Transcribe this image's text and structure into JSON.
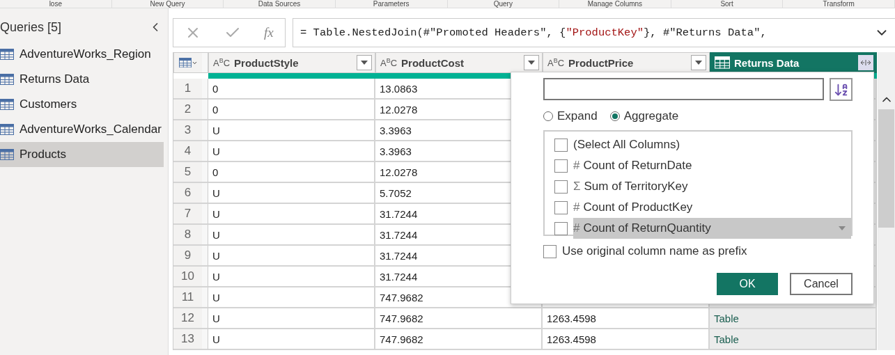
{
  "ribbon": {
    "groups": [
      "lose",
      "New Query",
      "Data Sources",
      "Parameters",
      "Query",
      "Manage Columns",
      "Sort",
      "Transform"
    ]
  },
  "queries": {
    "title": "Queries [5]",
    "items": [
      {
        "label": "AdventureWorks_Region",
        "selected": false
      },
      {
        "label": "Returns Data",
        "selected": false
      },
      {
        "label": "Customers",
        "selected": false
      },
      {
        "label": "AdventureWorks_Calendar",
        "selected": false
      },
      {
        "label": "Products",
        "selected": true
      }
    ]
  },
  "formula_bar": {
    "fx": "fx",
    "segments": [
      {
        "text": "= Table.NestedJoin(#\"Promoted Headers\", {",
        "kind": "plain"
      },
      {
        "text": "\"ProductKey\"",
        "kind": "string"
      },
      {
        "text": "}, #\"Returns Data\",",
        "kind": "plain"
      }
    ]
  },
  "table": {
    "columns": [
      {
        "name": "ProductStyle",
        "kind": "text",
        "type_icon": "A$^{B}$C",
        "selected": false
      },
      {
        "name": "ProductCost",
        "kind": "text",
        "type_icon": "A$^{B}$C",
        "selected": false
      },
      {
        "name": "ProductPrice",
        "kind": "text",
        "type_icon": "A$^{B}$C",
        "selected": false
      },
      {
        "name": "Returns Data",
        "kind": "table",
        "selected": true
      }
    ],
    "rows": [
      {
        "index": "1",
        "cells": [
          "0",
          "13.0863"
        ]
      },
      {
        "index": "2",
        "cells": [
          "0",
          "12.0278"
        ]
      },
      {
        "index": "3",
        "cells": [
          "U",
          "3.3963"
        ]
      },
      {
        "index": "4",
        "cells": [
          "U",
          "3.3963"
        ]
      },
      {
        "index": "5",
        "cells": [
          "0",
          "12.0278"
        ]
      },
      {
        "index": "6",
        "cells": [
          "U",
          "5.7052"
        ]
      },
      {
        "index": "7",
        "cells": [
          "U",
          "31.7244"
        ]
      },
      {
        "index": "8",
        "cells": [
          "U",
          "31.7244"
        ]
      },
      {
        "index": "9",
        "cells": [
          "U",
          "31.7244"
        ]
      },
      {
        "index": "10",
        "cells": [
          "U",
          "31.7244"
        ]
      },
      {
        "index": "11",
        "cells": [
          "U",
          "747.9682"
        ]
      },
      {
        "index": "12",
        "cells": [
          "U",
          "747.9682",
          "1263.4598",
          "Table"
        ]
      },
      {
        "index": "13",
        "cells": [
          "U",
          "747.9682",
          "1263.4598",
          "Table"
        ]
      }
    ]
  },
  "expand_popup": {
    "modes": [
      {
        "label": "Expand",
        "selected": false
      },
      {
        "label": "Aggregate",
        "selected": true
      }
    ],
    "columns": [
      {
        "label": "(Select All Columns)",
        "checked": false,
        "highlighted": false
      },
      {
        "symbol": "#",
        "label": "Count of ReturnDate",
        "checked": false,
        "highlighted": false
      },
      {
        "symbol": "Σ",
        "label": "Sum of TerritoryKey",
        "checked": false,
        "highlighted": false
      },
      {
        "symbol": "#",
        "label": "Count of ProductKey",
        "checked": false,
        "highlighted": false
      },
      {
        "symbol": "#",
        "label": "Count of ReturnQuantity",
        "checked": false,
        "highlighted": true
      }
    ],
    "prefix": {
      "label": "Use original column name as prefix",
      "checked": false
    },
    "buttons": [
      {
        "label": "OK",
        "kind": "primary"
      },
      {
        "label": "Cancel",
        "kind": "secondary"
      }
    ]
  }
}
